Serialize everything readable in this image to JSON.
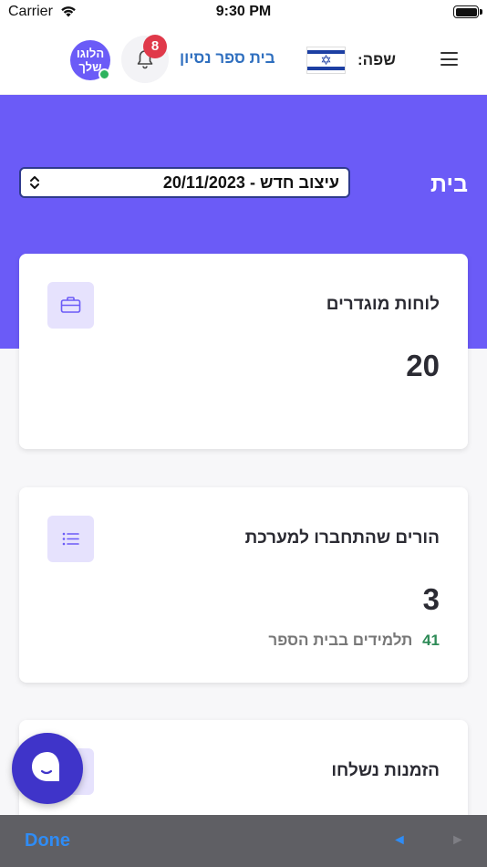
{
  "status_bar": {
    "carrier": "Carrier",
    "time": "9:30 PM"
  },
  "header": {
    "logo_text": "הלוגו שלך",
    "notifications_count": "8",
    "school_name": "בית ספר נסיון",
    "language_label": "שפה:",
    "flag_icon": "israel-flag-icon",
    "menu_icon": "hamburger-menu-icon"
  },
  "hero": {
    "page_title": "בית",
    "design_select_value": "עיצוב חדש - 20/11/2023"
  },
  "cards": [
    {
      "title": "לוחות מוגדרים",
      "value": "20",
      "icon": "briefcase-icon"
    },
    {
      "title": "הורים שהתחברו למערכת",
      "value": "3",
      "icon": "list-icon",
      "sub_count": "41",
      "sub_label": "תלמידים בבית הספר"
    },
    {
      "title": "הזמנות נשלחו",
      "icon": "invite-icon"
    }
  ],
  "chat": {
    "icon": "chat-bubble-icon"
  },
  "toolbar": {
    "done_label": "Done",
    "prev_glyph": "◄",
    "next_glyph": "►"
  },
  "colors": {
    "brand_purple": "#6b5bf7",
    "icon_bg": "#e6e2fd",
    "badge_red": "#e0394a",
    "accent_blue": "#2f6fbf",
    "success_green": "#2e8b57",
    "online_green": "#2db35d"
  }
}
